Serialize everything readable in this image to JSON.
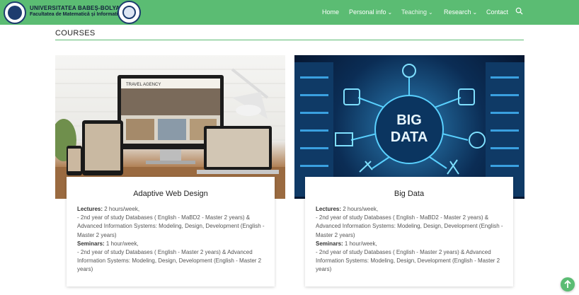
{
  "header": {
    "university": "UNIVERSITATEA BABEȘ-BOLYAI",
    "faculty": "Facultatea de Matematică și Informatică",
    "nav": [
      {
        "label": "Home"
      },
      {
        "label": "Personal info"
      },
      {
        "label": "Teaching"
      },
      {
        "label": "Research"
      },
      {
        "label": "Contact"
      }
    ],
    "search_icon": "search-icon"
  },
  "colors": {
    "brand_green": "#5bbc73",
    "nav_text": "#ffffff"
  },
  "page": {
    "title": "COURSES"
  },
  "courses": [
    {
      "title": "Adaptive Web Design",
      "image_caption": "TRAVEL AGENCY",
      "lectures_label": "Lectures:",
      "lectures_value": " 2 hours/week,",
      "lectures_detail": "- 2nd year of study Databases ( English - MaBD2 - Master 2 years) & Advanced Information Systems: Modeling, Design, Development (English - Master 2 years)",
      "seminars_label": "Seminars:",
      "seminars_value": " 1 hour/week,",
      "seminars_detail": "- 2nd year of study Databases ( English - Master 2 years) & Advanced Information Systems: Modeling, Design, Development (English - Master 2 years)"
    },
    {
      "title": "Big Data",
      "image_caption_1": "BIG",
      "image_caption_2": "DATA",
      "lectures_label": "Lectures:",
      "lectures_value": " 2 hours/week,",
      "lectures_detail": "- 2nd year of study Databases ( English - MaBD2 - Master 2 years) & Advanced Information Systems: Modeling, Design, Development (English - Master 2 years)",
      "seminars_label": "Seminars:",
      "seminars_value": " 1 hour/week,",
      "seminars_detail": "- 2nd year of study Databases ( English - Master 2 years) & Advanced Information Systems: Modeling, Design, Development (English - Master 2 years)"
    }
  ],
  "scroll_top_icon": "arrow-up-icon"
}
